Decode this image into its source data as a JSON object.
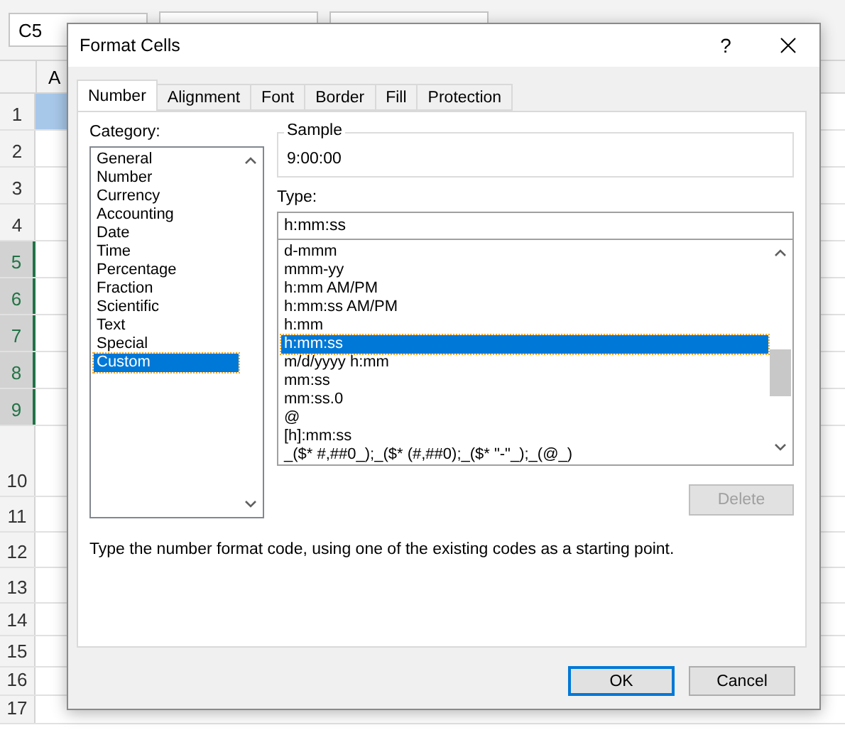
{
  "sheet": {
    "name_box": "C5",
    "column_header": "A",
    "rows": [
      {
        "label": "1",
        "selected": false,
        "highlighted": true
      },
      {
        "label": "2",
        "selected": false,
        "highlighted": false
      },
      {
        "label": "3",
        "selected": false,
        "highlighted": false
      },
      {
        "label": "4",
        "selected": false,
        "highlighted": false
      },
      {
        "label": "5",
        "selected": true,
        "highlighted": false
      },
      {
        "label": "6",
        "selected": true,
        "highlighted": false
      },
      {
        "label": "7",
        "selected": true,
        "highlighted": false
      },
      {
        "label": "8",
        "selected": true,
        "highlighted": false
      },
      {
        "label": "9",
        "selected": true,
        "highlighted": false
      },
      {
        "label": "10",
        "selected": false,
        "highlighted": false
      },
      {
        "label": "11",
        "selected": false,
        "highlighted": false
      },
      {
        "label": "12",
        "selected": false,
        "highlighted": false
      },
      {
        "label": "13",
        "selected": false,
        "highlighted": false
      },
      {
        "label": "14",
        "selected": false,
        "highlighted": false
      },
      {
        "label": "15",
        "selected": false,
        "highlighted": false
      },
      {
        "label": "16",
        "selected": false,
        "highlighted": false
      },
      {
        "label": "17",
        "selected": false,
        "highlighted": false
      }
    ]
  },
  "dialog": {
    "title": "Format Cells",
    "help": "?",
    "tabs": [
      {
        "label": "Number",
        "selected": true
      },
      {
        "label": "Alignment",
        "selected": false
      },
      {
        "label": "Font",
        "selected": false
      },
      {
        "label": "Border",
        "selected": false
      },
      {
        "label": "Fill",
        "selected": false
      },
      {
        "label": "Protection",
        "selected": false
      }
    ],
    "category_label": "Category:",
    "categories": [
      {
        "label": "General",
        "selected": false
      },
      {
        "label": "Number",
        "selected": false
      },
      {
        "label": "Currency",
        "selected": false
      },
      {
        "label": "Accounting",
        "selected": false
      },
      {
        "label": "Date",
        "selected": false
      },
      {
        "label": "Time",
        "selected": false
      },
      {
        "label": "Percentage",
        "selected": false
      },
      {
        "label": "Fraction",
        "selected": false
      },
      {
        "label": "Scientific",
        "selected": false
      },
      {
        "label": "Text",
        "selected": false
      },
      {
        "label": "Special",
        "selected": false
      },
      {
        "label": "Custom",
        "selected": true
      }
    ],
    "sample_label": "Sample",
    "sample_value": "9:00:00",
    "type_label": "Type:",
    "type_value": "h:mm:ss",
    "types": [
      {
        "label": "d-mmm",
        "selected": false
      },
      {
        "label": "mmm-yy",
        "selected": false
      },
      {
        "label": "h:mm AM/PM",
        "selected": false
      },
      {
        "label": "h:mm:ss AM/PM",
        "selected": false
      },
      {
        "label": "h:mm",
        "selected": false
      },
      {
        "label": "h:mm:ss",
        "selected": true
      },
      {
        "label": "m/d/yyyy h:mm",
        "selected": false
      },
      {
        "label": "mm:ss",
        "selected": false
      },
      {
        "label": "mm:ss.0",
        "selected": false
      },
      {
        "label": "@",
        "selected": false
      },
      {
        "label": "[h]:mm:ss",
        "selected": false
      },
      {
        "label": "_($* #,##0_);_($* (#,##0);_($* \"-\"_);_(@_)",
        "selected": false
      }
    ],
    "delete_button": {
      "label": "Delete",
      "disabled": true
    },
    "description": "Type the number format code, using one of the existing codes as a starting point.",
    "buttons": [
      {
        "label": "OK",
        "kind": "default"
      },
      {
        "label": "Cancel",
        "kind": "normal"
      }
    ]
  }
}
